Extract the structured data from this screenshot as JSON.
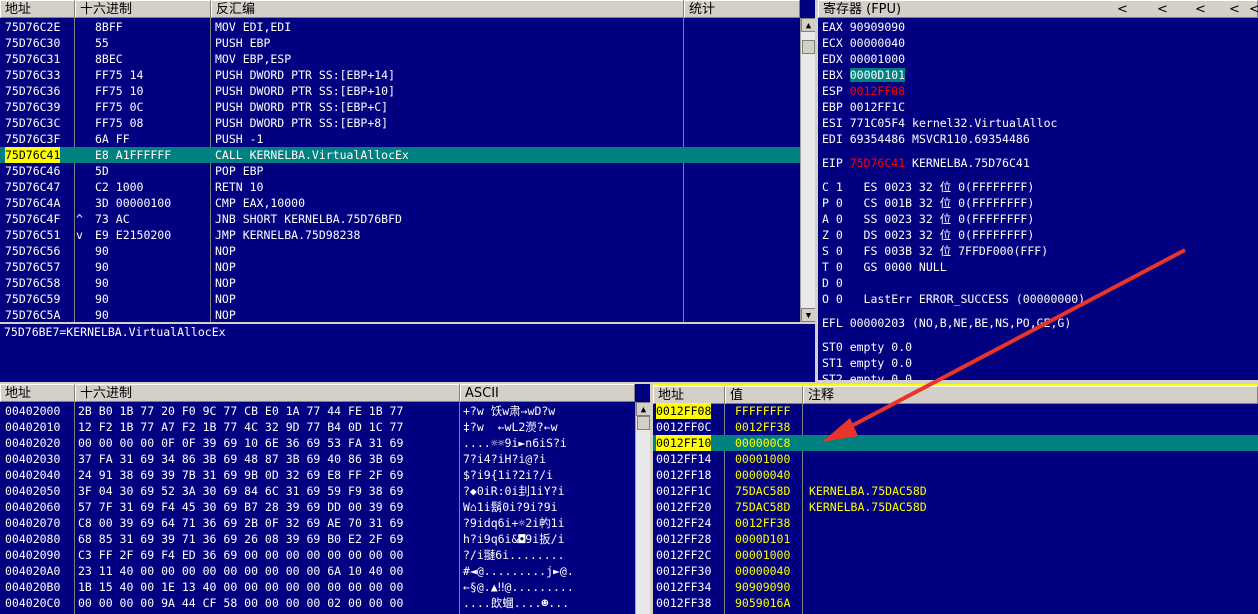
{
  "disasm": {
    "headers": [
      "地址",
      "十六进制",
      "反汇编",
      "统计"
    ],
    "rows": [
      {
        "addr": "75D76C2E",
        "mark": "",
        "hex": "8BFF",
        "asm": "MOV EDI,EDI"
      },
      {
        "addr": "75D76C30",
        "mark": "",
        "hex": "55",
        "asm": "PUSH EBP"
      },
      {
        "addr": "75D76C31",
        "mark": "",
        "hex": "8BEC",
        "asm": "MOV EBP,ESP"
      },
      {
        "addr": "75D76C33",
        "mark": "",
        "hex": "FF75 14",
        "asm": "PUSH DWORD PTR SS:[EBP+14]"
      },
      {
        "addr": "75D76C36",
        "mark": "",
        "hex": "FF75 10",
        "asm": "PUSH DWORD PTR SS:[EBP+10]"
      },
      {
        "addr": "75D76C39",
        "mark": "",
        "hex": "FF75 0C",
        "asm": "PUSH DWORD PTR SS:[EBP+C]"
      },
      {
        "addr": "75D76C3C",
        "mark": "",
        "hex": "FF75 08",
        "asm": "PUSH DWORD PTR SS:[EBP+8]"
      },
      {
        "addr": "75D76C3F",
        "mark": "",
        "hex": "6A FF",
        "asm": "PUSH -1"
      },
      {
        "addr": "75D76C41",
        "mark": "",
        "hex": "E8 A1FFFFFF",
        "asm": "CALL KERNELBA.VirtualAllocEx"
      },
      {
        "addr": "75D76C46",
        "mark": "",
        "hex": "5D",
        "asm": "POP EBP"
      },
      {
        "addr": "75D76C47",
        "mark": "",
        "hex": "C2 1000",
        "asm": "RETN 10"
      },
      {
        "addr": "75D76C4A",
        "mark": "",
        "hex": "3D 00000100",
        "asm": "CMP EAX,10000"
      },
      {
        "addr": "75D76C4F",
        "mark": "^",
        "hex": "73 AC",
        "asm": "JNB SHORT KERNELBA.75D76BFD"
      },
      {
        "addr": "75D76C51",
        "mark": "v",
        "hex": "E9 E2150200",
        "asm": "JMP KERNELBA.75D98238"
      },
      {
        "addr": "75D76C56",
        "mark": "",
        "hex": "90",
        "asm": "NOP"
      },
      {
        "addr": "75D76C57",
        "mark": "",
        "hex": "90",
        "asm": "NOP"
      },
      {
        "addr": "75D76C58",
        "mark": "",
        "hex": "90",
        "asm": "NOP"
      },
      {
        "addr": "75D76C59",
        "mark": "",
        "hex": "90",
        "asm": "NOP"
      },
      {
        "addr": "75D76C5A",
        "mark": "",
        "hex": "90",
        "asm": "NOP"
      }
    ],
    "info": "75D76BE7=KERNELBA.VirtualAllocEx"
  },
  "registers": {
    "title": "寄存器 (FPU)",
    "arrows": [
      "<",
      "<",
      "<",
      "<",
      "<"
    ],
    "gp": [
      {
        "name": "EAX",
        "val": "90909090",
        "note": ""
      },
      {
        "name": "ECX",
        "val": "00000040",
        "note": ""
      },
      {
        "name": "EDX",
        "val": "00001000",
        "note": ""
      },
      {
        "name": "EBX",
        "val": "0000D101",
        "note": ""
      },
      {
        "name": "ESP",
        "val": "0012FF08",
        "note": ""
      },
      {
        "name": "EBP",
        "val": "0012FF1C",
        "note": ""
      },
      {
        "name": "ESI",
        "val": "771C05F4",
        "note": "kernel32.VirtualAlloc"
      },
      {
        "name": "EDI",
        "val": "69354486",
        "note": "MSVCR110.69354486"
      }
    ],
    "eip": {
      "name": "EIP",
      "val": "75D76C41",
      "note": "KERNELBA.75D76C41"
    },
    "flags": [
      "C 1   ES 0023 32 位 0(FFFFFFFF)",
      "P 0   CS 001B 32 位 0(FFFFFFFF)",
      "A 0   SS 0023 32 位 0(FFFFFFFF)",
      "Z 0   DS 0023 32 位 0(FFFFFFFF)",
      "S 0   FS 003B 32 位 7FFDF000(FFF)",
      "T 0   GS 0000 NULL",
      "D 0",
      "O 0   LastErr ERROR_SUCCESS (00000000)"
    ],
    "efl": "EFL 00000203 (NO,B,NE,BE,NS,PO,GE,G)",
    "st": [
      "ST0 empty 0.0",
      "ST1 empty 0.0",
      "ST2 empty 0.0"
    ]
  },
  "dump": {
    "headers": [
      "地址",
      "十六进制",
      "ASCII"
    ],
    "rows": [
      {
        "addr": "00402000",
        "hex": "2B B0 1B 77 20 F0 9C 77 CB E0 1A 77 44 FE 1B 77",
        "ascii": "+?w 饫w肃→wD?w"
      },
      {
        "addr": "00402010",
        "hex": "12 F2 1B 77 A7 F2 1B 77 4C 32 9D 77 B4 0D 1C 77",
        "ascii": "‡?w  ←wL2濙?←w"
      },
      {
        "addr": "00402020",
        "hex": "00 00 00 00 0F 0F 39 69 10 6E 36 69 53 FA 31 69",
        "ascii": "....☼☼9i►n6iS?i"
      },
      {
        "addr": "00402030",
        "hex": "37 FA 31 69 34 86 3B 69 48 87 3B 69 40 86 3B 69",
        "ascii": "7?i4?iH?i@?i"
      },
      {
        "addr": "00402040",
        "hex": "24 91 38 69 39 7B 31 69 9B 0D 32 69 E8 FF 2F 69",
        "ascii": "$?i9{1i?2i?/i"
      },
      {
        "addr": "00402050",
        "hex": "3F 04 30 69 52 3A 30 69 84 6C 31 69 59 F9 38 69",
        "ascii": "?◆0iR:0i刲1iY?i"
      },
      {
        "addr": "00402060",
        "hex": "57 7F 31 69 F4 45 30 69 B7 28 39 69 DD 00 39 69",
        "ascii": "W⌂1i鬍0i?9i?9i"
      },
      {
        "addr": "00402070",
        "hex": "C8 00 39 69 64 71 36 69 2B 0F 32 69 AE 70 31 69",
        "ascii": "?9idq6i+☼2i畃1i"
      },
      {
        "addr": "00402080",
        "hex": "68 85 31 69 39 71 36 69 26 08 39 69 B0 E2 2F 69",
        "ascii": "h?i9q6i&◘9i扳/i"
      },
      {
        "addr": "00402090",
        "hex": "C3 FF 2F 69 F4 ED 36 69 00 00 00 00 00 00 00 00",
        "ascii": "?/i翴6i........"
      },
      {
        "addr": "004020A0",
        "hex": "23 11 40 00 00 00 00 00 00 00 00 00 6A 10 40 00",
        "ascii": "#◄@.........j►@."
      },
      {
        "addr": "004020B0",
        "hex": "1B 15 40 00 1E 13 40 00 00 00 00 00 00 00 00 00",
        "ascii": "←§@.▲‼@........."
      },
      {
        "addr": "004020C0",
        "hex": "00 00 00 00 9A 44 CF 58 00 00 00 00 02 00 00 00",
        "ascii": "....欴蟈....☻..."
      }
    ]
  },
  "stack": {
    "headers": [
      "地址",
      "值",
      "注释"
    ],
    "rows": [
      {
        "addr": "0012FF08",
        "val": "FFFFFFFF",
        "note": ""
      },
      {
        "addr": "0012FF0C",
        "val": "0012FF38",
        "note": ""
      },
      {
        "addr": "0012FF10",
        "val": "000000C8",
        "note": ""
      },
      {
        "addr": "0012FF14",
        "val": "00001000",
        "note": ""
      },
      {
        "addr": "0012FF18",
        "val": "00000040",
        "note": ""
      },
      {
        "addr": "0012FF1C",
        "val": "75DAC58D",
        "note": "KERNELBA.75DAC58D"
      },
      {
        "addr": "0012FF20",
        "val": "75DAC58D",
        "note": "KERNELBA.75DAC58D"
      },
      {
        "addr": "0012FF24",
        "val": "0012FF38",
        "note": ""
      },
      {
        "addr": "0012FF28",
        "val": "0000D101",
        "note": ""
      },
      {
        "addr": "0012FF2C",
        "val": "00001000",
        "note": ""
      },
      {
        "addr": "0012FF30",
        "val": "00000040",
        "note": ""
      },
      {
        "addr": "0012FF34",
        "val": "90909090",
        "note": ""
      },
      {
        "addr": "0012FF38",
        "val": "9059016A",
        "note": ""
      }
    ]
  },
  "colors": {
    "pane_bg": "#000080",
    "highlight": "#008080",
    "accent_yellow": "#ffff00",
    "accent_red": "#ff0000",
    "arrow": "#e8342a"
  }
}
